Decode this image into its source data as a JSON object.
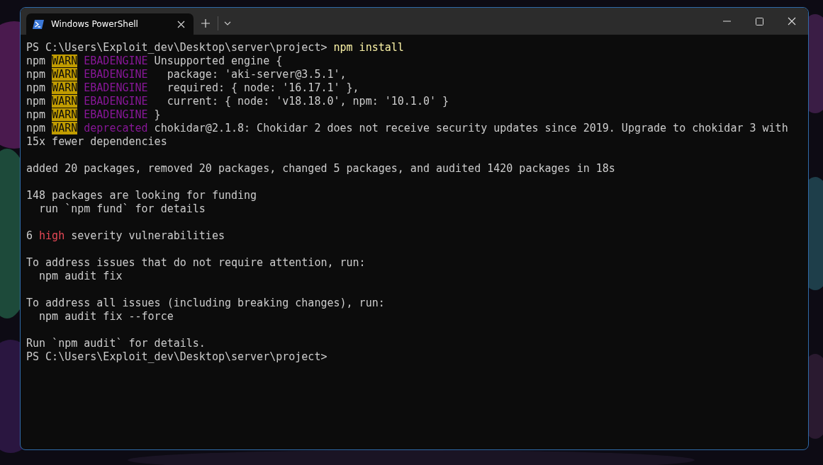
{
  "window": {
    "tab": {
      "title": "Windows PowerShell",
      "selected": true
    }
  },
  "terminal": {
    "lines": [
      {
        "kind": "text",
        "segments": [
          {
            "kind": "plain",
            "text": "PS C:\\Users\\Exploit_dev\\Desktop\\server\\project> "
          },
          {
            "kind": "command",
            "text": "npm install"
          }
        ]
      },
      {
        "kind": "text",
        "segments": [
          {
            "kind": "plain",
            "text": "npm "
          },
          {
            "kind": "warn",
            "text": "WARN"
          },
          {
            "kind": "code",
            "text": " EBADENGINE"
          },
          {
            "kind": "plain",
            "text": " Unsupported engine {"
          }
        ]
      },
      {
        "kind": "text",
        "segments": [
          {
            "kind": "plain",
            "text": "npm "
          },
          {
            "kind": "warn",
            "text": "WARN"
          },
          {
            "kind": "code",
            "text": " EBADENGINE"
          },
          {
            "kind": "plain",
            "text": "   package: 'aki-server@3.5.1',"
          }
        ]
      },
      {
        "kind": "text",
        "segments": [
          {
            "kind": "plain",
            "text": "npm "
          },
          {
            "kind": "warn",
            "text": "WARN"
          },
          {
            "kind": "code",
            "text": " EBADENGINE"
          },
          {
            "kind": "plain",
            "text": "   required: { node: '16.17.1' },"
          }
        ]
      },
      {
        "kind": "text",
        "segments": [
          {
            "kind": "plain",
            "text": "npm "
          },
          {
            "kind": "warn",
            "text": "WARN"
          },
          {
            "kind": "code",
            "text": " EBADENGINE"
          },
          {
            "kind": "plain",
            "text": "   current: { node: 'v18.18.0', npm: '10.1.0' }"
          }
        ]
      },
      {
        "kind": "text",
        "segments": [
          {
            "kind": "plain",
            "text": "npm "
          },
          {
            "kind": "warn",
            "text": "WARN"
          },
          {
            "kind": "code",
            "text": " EBADENGINE"
          },
          {
            "kind": "plain",
            "text": " }"
          }
        ]
      },
      {
        "kind": "text",
        "segments": [
          {
            "kind": "plain",
            "text": "npm "
          },
          {
            "kind": "warn",
            "text": "WARN"
          },
          {
            "kind": "code",
            "text": " deprecated"
          },
          {
            "kind": "plain",
            "text": " chokidar@2.1.8: Chokidar 2 does not receive security updates since 2019. Upgrade to chokidar 3 with"
          }
        ]
      },
      {
        "kind": "text",
        "segments": [
          {
            "kind": "plain",
            "text": "15x fewer dependencies"
          }
        ]
      },
      {
        "kind": "blank"
      },
      {
        "kind": "text",
        "segments": [
          {
            "kind": "plain",
            "text": "added 20 packages, removed 20 packages, changed 5 packages, and audited 1420 packages in 18s"
          }
        ]
      },
      {
        "kind": "blank"
      },
      {
        "kind": "text",
        "segments": [
          {
            "kind": "plain",
            "text": "148 packages are looking for funding"
          }
        ]
      },
      {
        "kind": "text",
        "segments": [
          {
            "kind": "plain",
            "text": "  run `npm fund` for details"
          }
        ]
      },
      {
        "kind": "blank"
      },
      {
        "kind": "text",
        "segments": [
          {
            "kind": "plain",
            "text": "6 "
          },
          {
            "kind": "error",
            "text": "high"
          },
          {
            "kind": "plain",
            "text": " severity vulnerabilities"
          }
        ]
      },
      {
        "kind": "blank"
      },
      {
        "kind": "text",
        "segments": [
          {
            "kind": "plain",
            "text": "To address issues that do not require attention, run:"
          }
        ]
      },
      {
        "kind": "text",
        "segments": [
          {
            "kind": "plain",
            "text": "  npm audit fix"
          }
        ]
      },
      {
        "kind": "blank"
      },
      {
        "kind": "text",
        "segments": [
          {
            "kind": "plain",
            "text": "To address all issues (including breaking changes), run:"
          }
        ]
      },
      {
        "kind": "text",
        "segments": [
          {
            "kind": "plain",
            "text": "  npm audit fix --force"
          }
        ]
      },
      {
        "kind": "blank"
      },
      {
        "kind": "text",
        "segments": [
          {
            "kind": "plain",
            "text": "Run `npm audit` for details."
          }
        ]
      },
      {
        "kind": "text",
        "segments": [
          {
            "kind": "plain",
            "text": "PS C:\\Users\\Exploit_dev\\Desktop\\server\\project>"
          }
        ]
      }
    ]
  }
}
